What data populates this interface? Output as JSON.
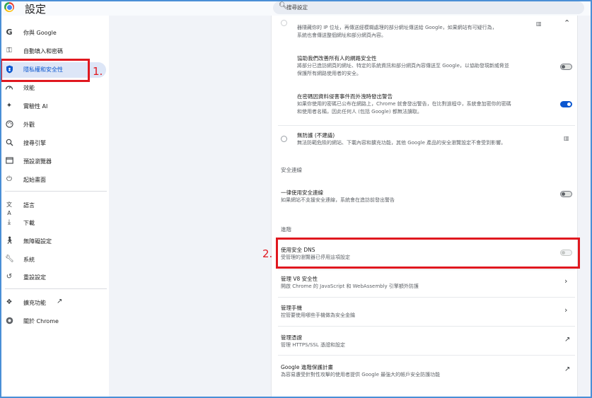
{
  "app": {
    "title": "設定"
  },
  "search": {
    "placeholder": "搜尋設定"
  },
  "sidebar": {
    "items": [
      {
        "label": "你與 Google",
        "icon": "google-icon"
      },
      {
        "label": "自動填入和密碼",
        "icon": "key-icon"
      },
      {
        "label": "隱私權和安全性",
        "icon": "shield-icon"
      },
      {
        "label": "效能",
        "icon": "speedometer-icon"
      },
      {
        "label": "實驗性 AI",
        "icon": "sparkle-icon"
      },
      {
        "label": "外觀",
        "icon": "palette-icon"
      },
      {
        "label": "搜尋引擎",
        "icon": "search-icon"
      },
      {
        "label": "預設瀏覽器",
        "icon": "browser-icon"
      },
      {
        "label": "起始畫面",
        "icon": "power-icon"
      },
      {
        "label": "語言",
        "icon": "translate-icon"
      },
      {
        "label": "下載",
        "icon": "download-icon"
      },
      {
        "label": "無障礙設定",
        "icon": "accessibility-icon"
      },
      {
        "label": "系統",
        "icon": "wrench-icon"
      },
      {
        "label": "重設設定",
        "icon": "reset-icon"
      },
      {
        "label": "擴充功能",
        "icon": "puzzle-icon"
      },
      {
        "label": "關於 Chrome",
        "icon": "chrome-icon"
      }
    ]
  },
  "annotations": {
    "one": "1.",
    "two": "2."
  },
  "main": {
    "enhanced": {
      "line1": "器隱藏你的 IP 位址，再傳送經模糊處理的部分網址傳送給 Google，如果網站有可疑行為，",
      "line2": "系統也會傳送整個網址和部分網頁內容。"
    },
    "help_improve": {
      "title": "協助我們改善所有人的網路安全性",
      "desc1": "將部分已造訪網頁的網址、特定的系統資訊和部分網頁內容傳送至 Google，以協助發現新威脅並",
      "desc2": "保護所有網路使用者的安全。"
    },
    "password_leak": {
      "title": "在密碼因資料侵害事件而外洩時發出警告",
      "desc1": "如果你使用的密碼已公布在網路上，Chrome 就會發出警告，在比對過程中，系統會加密你的密碼",
      "desc2": "和使用者名稱，因此任何人 (包括 Google) 都無法讀取。"
    },
    "no_protection": {
      "title": "無防護 (不建議)",
      "desc": "無法防範危險的網站、下載內容和擴充功能，其他 Google 產品的安全瀏覽設定不會受到影響。"
    },
    "secure_connections": {
      "heading": "安全連線",
      "always_title": "一律使用安全連線",
      "always_desc": "如果網站不支援安全連線，系統會在造訪前發出警告"
    },
    "advanced": {
      "heading": "進階",
      "dns_title": "使用安全 DNS",
      "dns_desc": "受管理的瀏覽器已停用這項設定",
      "v8_title": "管理 V8 安全性",
      "v8_desc": "開啟 Chrome 的 JavaScript 和 WebAssembly 引擎額外防護",
      "phones_title": "管理手機",
      "phones_desc": "控管要使用哪些手機做為安全金鑰",
      "certs_title": "管理憑證",
      "certs_desc": "管理 HTTPS/SSL 憑證和設定",
      "app_title": "Google 進階保護計畫",
      "app_desc": "為容易遭受針對性攻擊的使用者提供 Google 最強大的帳戶安全防護功能"
    },
    "toggles": {
      "help_improve": false,
      "password_leak": true,
      "always_secure": false,
      "secure_dns": false
    }
  },
  "colors": {
    "accent": "#0b57d0",
    "annotation_red": "#e0181f",
    "active_nav_bg": "#dde6f7",
    "page_bg": "#f1f3f8"
  }
}
